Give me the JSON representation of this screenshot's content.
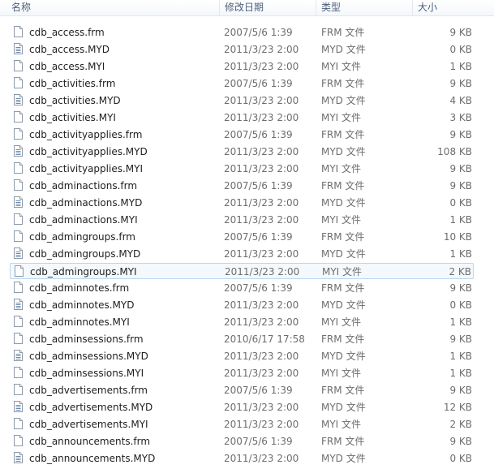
{
  "columns": {
    "name": "名称",
    "date": "修改日期",
    "type": "类型",
    "size": "大小"
  },
  "rows": [
    {
      "name": "cdb_access.frm",
      "date": "2007/5/6 1:39",
      "type": "FRM 文件",
      "size": "9 KB",
      "icon": "plain-file-icon"
    },
    {
      "name": "cdb_access.MYD",
      "date": "2011/3/23 2:00",
      "type": "MYD 文件",
      "size": "0 KB",
      "icon": "data-file-icon"
    },
    {
      "name": "cdb_access.MYI",
      "date": "2011/3/23 2:00",
      "type": "MYI 文件",
      "size": "1 KB",
      "icon": "plain-file-icon"
    },
    {
      "name": "cdb_activities.frm",
      "date": "2007/5/6 1:39",
      "type": "FRM 文件",
      "size": "9 KB",
      "icon": "plain-file-icon"
    },
    {
      "name": "cdb_activities.MYD",
      "date": "2011/3/23 2:00",
      "type": "MYD 文件",
      "size": "4 KB",
      "icon": "data-file-icon"
    },
    {
      "name": "cdb_activities.MYI",
      "date": "2011/3/23 2:00",
      "type": "MYI 文件",
      "size": "3 KB",
      "icon": "plain-file-icon"
    },
    {
      "name": "cdb_activityapplies.frm",
      "date": "2007/5/6 1:39",
      "type": "FRM 文件",
      "size": "9 KB",
      "icon": "plain-file-icon"
    },
    {
      "name": "cdb_activityapplies.MYD",
      "date": "2011/3/23 2:00",
      "type": "MYD 文件",
      "size": "108 KB",
      "icon": "data-file-icon"
    },
    {
      "name": "cdb_activityapplies.MYI",
      "date": "2011/3/23 2:00",
      "type": "MYI 文件",
      "size": "9 KB",
      "icon": "plain-file-icon"
    },
    {
      "name": "cdb_adminactions.frm",
      "date": "2007/5/6 1:39",
      "type": "FRM 文件",
      "size": "9 KB",
      "icon": "plain-file-icon"
    },
    {
      "name": "cdb_adminactions.MYD",
      "date": "2011/3/23 2:00",
      "type": "MYD 文件",
      "size": "0 KB",
      "icon": "data-file-icon"
    },
    {
      "name": "cdb_adminactions.MYI",
      "date": "2011/3/23 2:00",
      "type": "MYI 文件",
      "size": "1 KB",
      "icon": "plain-file-icon"
    },
    {
      "name": "cdb_admingroups.frm",
      "date": "2007/5/6 1:39",
      "type": "FRM 文件",
      "size": "10 KB",
      "icon": "plain-file-icon"
    },
    {
      "name": "cdb_admingroups.MYD",
      "date": "2011/3/23 2:00",
      "type": "MYD 文件",
      "size": "1 KB",
      "icon": "data-file-icon"
    },
    {
      "name": "cdb_admingroups.MYI",
      "date": "2011/3/23 2:00",
      "type": "MYI 文件",
      "size": "2 KB",
      "icon": "plain-file-icon",
      "selected": true
    },
    {
      "name": "cdb_adminnotes.frm",
      "date": "2007/5/6 1:39",
      "type": "FRM 文件",
      "size": "9 KB",
      "icon": "plain-file-icon"
    },
    {
      "name": "cdb_adminnotes.MYD",
      "date": "2011/3/23 2:00",
      "type": "MYD 文件",
      "size": "0 KB",
      "icon": "data-file-icon"
    },
    {
      "name": "cdb_adminnotes.MYI",
      "date": "2011/3/23 2:00",
      "type": "MYI 文件",
      "size": "1 KB",
      "icon": "plain-file-icon"
    },
    {
      "name": "cdb_adminsessions.frm",
      "date": "2010/6/17 17:58",
      "type": "FRM 文件",
      "size": "9 KB",
      "icon": "plain-file-icon"
    },
    {
      "name": "cdb_adminsessions.MYD",
      "date": "2011/3/23 2:00",
      "type": "MYD 文件",
      "size": "1 KB",
      "icon": "data-file-icon"
    },
    {
      "name": "cdb_adminsessions.MYI",
      "date": "2011/3/23 2:00",
      "type": "MYI 文件",
      "size": "1 KB",
      "icon": "plain-file-icon"
    },
    {
      "name": "cdb_advertisements.frm",
      "date": "2007/5/6 1:39",
      "type": "FRM 文件",
      "size": "9 KB",
      "icon": "plain-file-icon"
    },
    {
      "name": "cdb_advertisements.MYD",
      "date": "2011/3/23 2:00",
      "type": "MYD 文件",
      "size": "12 KB",
      "icon": "data-file-icon"
    },
    {
      "name": "cdb_advertisements.MYI",
      "date": "2011/3/23 2:00",
      "type": "MYI 文件",
      "size": "2 KB",
      "icon": "plain-file-icon"
    },
    {
      "name": "cdb_announcements.frm",
      "date": "2007/5/6 1:39",
      "type": "FRM 文件",
      "size": "9 KB",
      "icon": "plain-file-icon"
    },
    {
      "name": "cdb_announcements.MYD",
      "date": "2011/3/23 2:00",
      "type": "MYD 文件",
      "size": "0 KB",
      "icon": "data-file-icon"
    }
  ],
  "colors": {
    "selection_border": "#b8d6f0",
    "selection_fill": "#f4f9fd",
    "header_text": "#4c607a",
    "secondary_text": "#6d6d6d"
  }
}
